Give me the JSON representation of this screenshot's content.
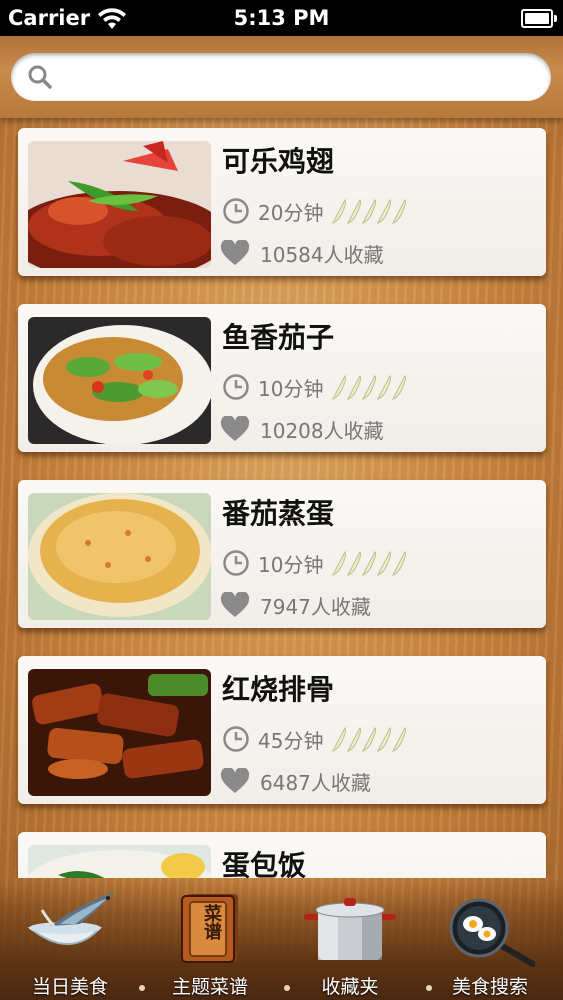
{
  "status_bar": {
    "carrier": "Carrier",
    "time": "5:13 PM"
  },
  "search": {
    "placeholder": ""
  },
  "recipes": [
    {
      "name": "可乐鸡翅",
      "time": "20分钟",
      "favorites": "10584人收藏",
      "spice_level_of_5": 0
    },
    {
      "name": "鱼香茄子",
      "time": "10分钟",
      "favorites": "10208人收藏",
      "spice_level_of_5": 0
    },
    {
      "name": "番茄蒸蛋",
      "time": "10分钟",
      "favorites": "7947人收藏",
      "spice_level_of_5": 0
    },
    {
      "name": "红烧排骨",
      "time": "45分钟",
      "favorites": "6487人收藏",
      "spice_level_of_5": 0
    },
    {
      "name": "蛋包饭",
      "time": "",
      "favorites": "",
      "spice_level_of_5": 0
    }
  ],
  "tab_bar": {
    "tabs": [
      {
        "label": "当日美食",
        "icon": "fish-bowl-icon"
      },
      {
        "label": "主题菜谱",
        "icon": "recipe-book-icon",
        "icon_text": "菜谱"
      },
      {
        "label": "收藏夹",
        "icon": "cooking-pot-icon"
      },
      {
        "label": "美食搜索",
        "icon": "frying-pan-icon"
      }
    ]
  },
  "colors": {
    "wood": "#c9843e",
    "card": "#f7f4f0",
    "tab_bar": "#5e3414"
  }
}
